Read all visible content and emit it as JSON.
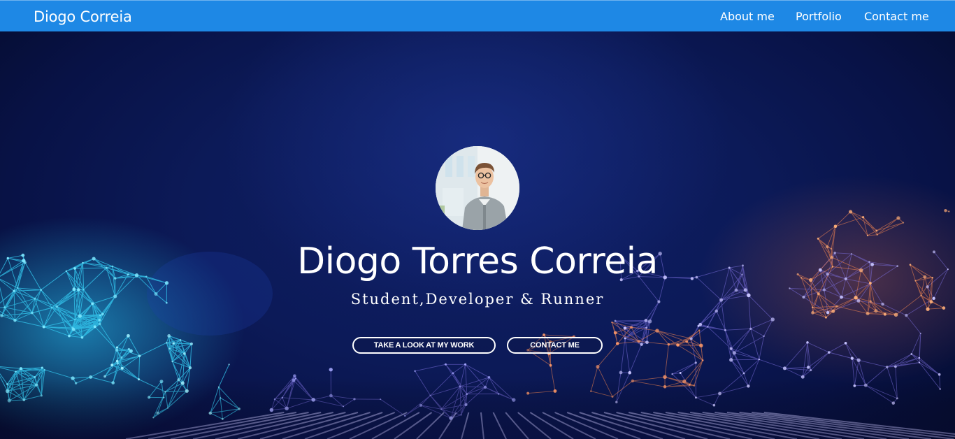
{
  "navbar": {
    "brand": "Diogo Correia",
    "links": [
      {
        "label": "About me"
      },
      {
        "label": "Portfolio"
      },
      {
        "label": "Contact me"
      }
    ]
  },
  "hero": {
    "name": "Diogo Torres Correia",
    "subtitle": "Student,Developer & Runner",
    "buttons": {
      "work": "TAKE A LOOK AT MY WORK",
      "contact": "CONTACT ME"
    }
  },
  "colors": {
    "navbar": "#1e88e5",
    "hero_background": "#0c1a58",
    "text": "#ffffff",
    "network_cyan": "#2ad4ff",
    "network_orange": "#ff9a5a",
    "network_violet": "#8a8cff"
  }
}
